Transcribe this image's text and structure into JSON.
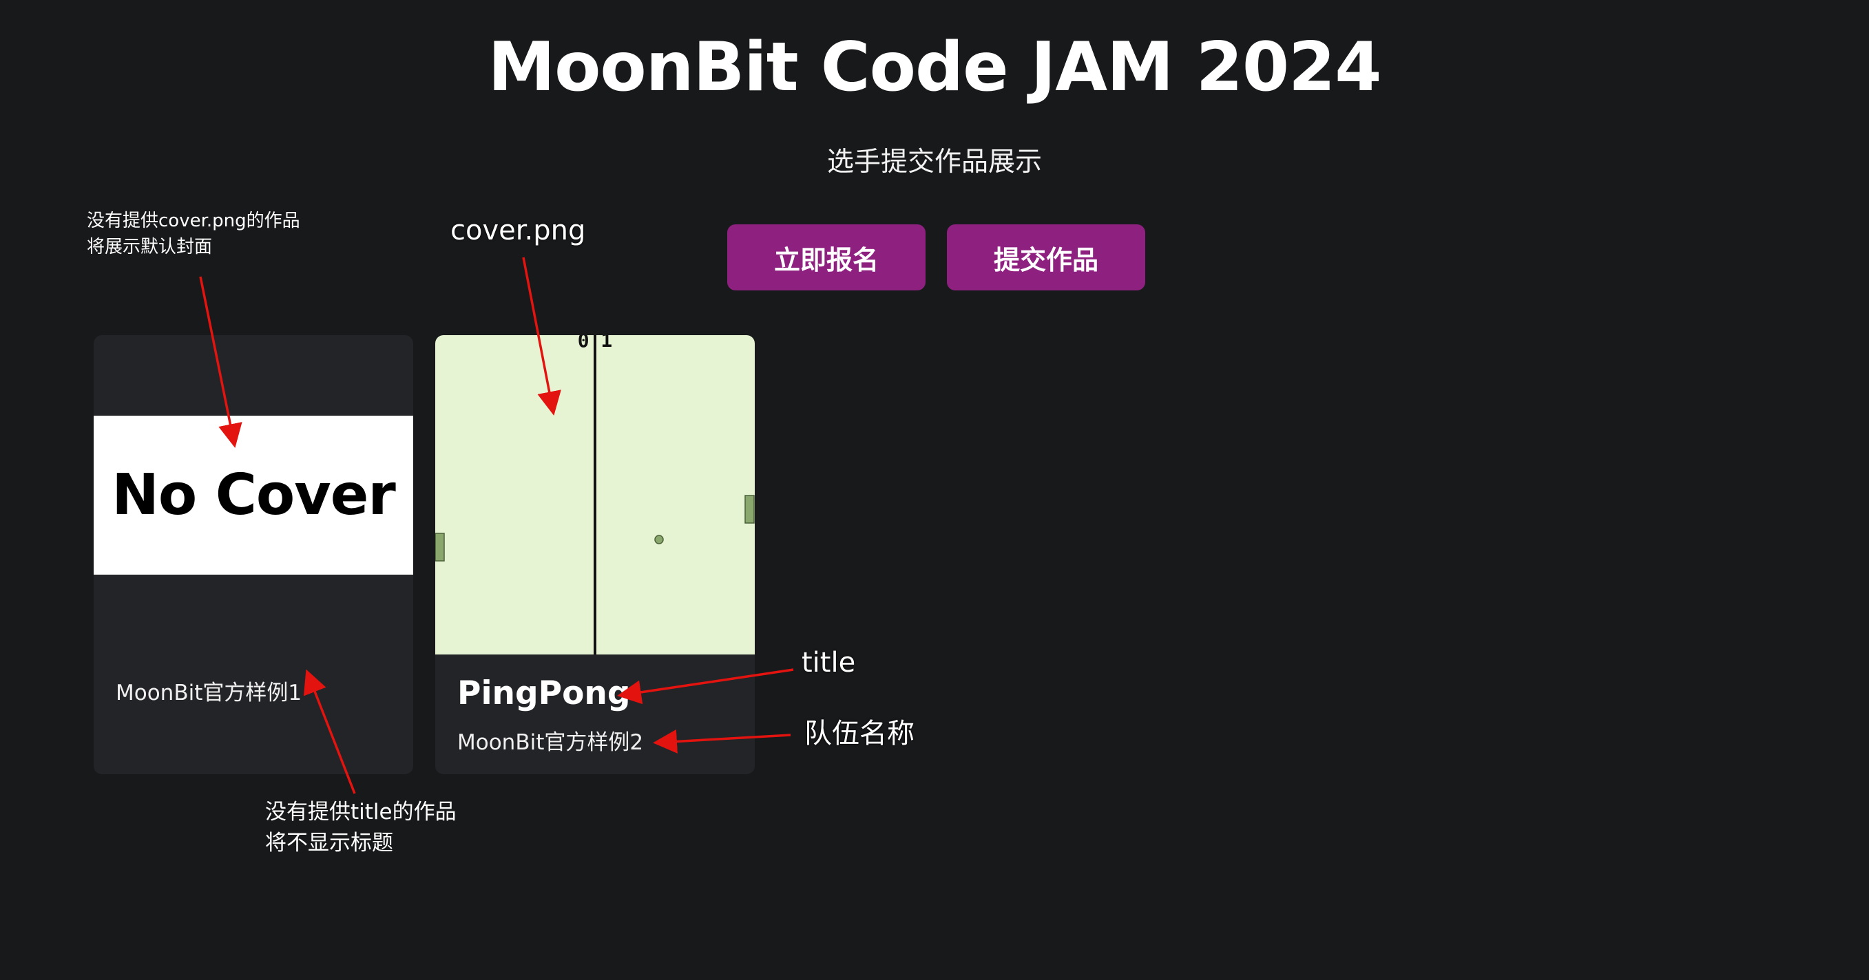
{
  "header": {
    "title": "MoonBit Code JAM 2024",
    "subtitle": "选手提交作品展示"
  },
  "actions": {
    "register_label": "立即报名",
    "submit_label": "提交作品"
  },
  "projects": [
    {
      "cover_text": "No Cover",
      "title": "",
      "team": "MoonBit官方样例1"
    },
    {
      "cover": {
        "score": "0 1"
      },
      "title": "PingPong",
      "team": "MoonBit官方样例2"
    }
  ],
  "annotations": {
    "no_cover_line1": "没有提供cover.png的作品",
    "no_cover_line2": "将展示默认封面",
    "cover_png": "cover.png",
    "title": "title",
    "team_name": "队伍名称",
    "no_title_line1": "没有提供title的作品",
    "no_title_line2": "将不显示标题"
  },
  "colors": {
    "background": "#18191b",
    "card": "#232427",
    "button": "#8e2180",
    "arrow": "#e3130f",
    "cover_bg": "#e6f4d4",
    "paddle": "#8aa86e"
  }
}
